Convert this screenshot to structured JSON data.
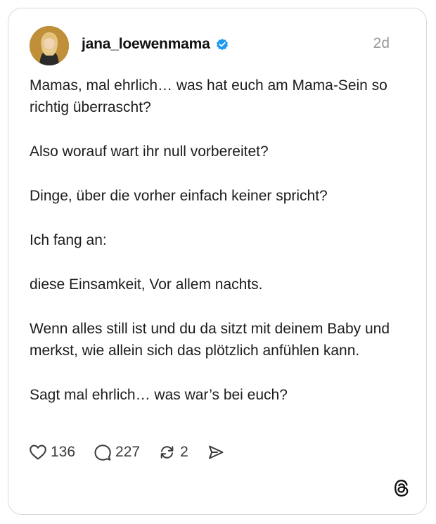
{
  "post": {
    "username": "jana_loewenmama",
    "timestamp": "2d",
    "paragraphs": [
      "Mamas, mal ehrlich… was hat euch am Mama-Sein so richtig überrascht?",
      "Also worauf wart ihr null vorbereitet?",
      "Dinge, über die vorher einfach keiner spricht?",
      "Ich fang an:",
      "diese Einsamkeit, Vor allem nachts.",
      "Wenn alles still ist und du da sitzt mit deinem Baby und merkst, wie allein sich das plötzlich anfühlen kann.",
      "Sagt mal ehrlich… was war’s bei euch?"
    ]
  },
  "actions": {
    "likes": "136",
    "comments": "227",
    "reposts": "2"
  },
  "icons": {
    "avatar": "profile-photo",
    "verified": "verified-badge-icon",
    "like": "heart-icon",
    "comment": "comment-bubble-icon",
    "repost": "repost-icon",
    "share": "send-icon",
    "brand": "threads-logo-icon"
  },
  "colors": {
    "verified": "#1d9bf0",
    "avatar_bg": "#c89a3a",
    "timestamp": "#9a9a9a",
    "text": "#1c1c1c"
  }
}
